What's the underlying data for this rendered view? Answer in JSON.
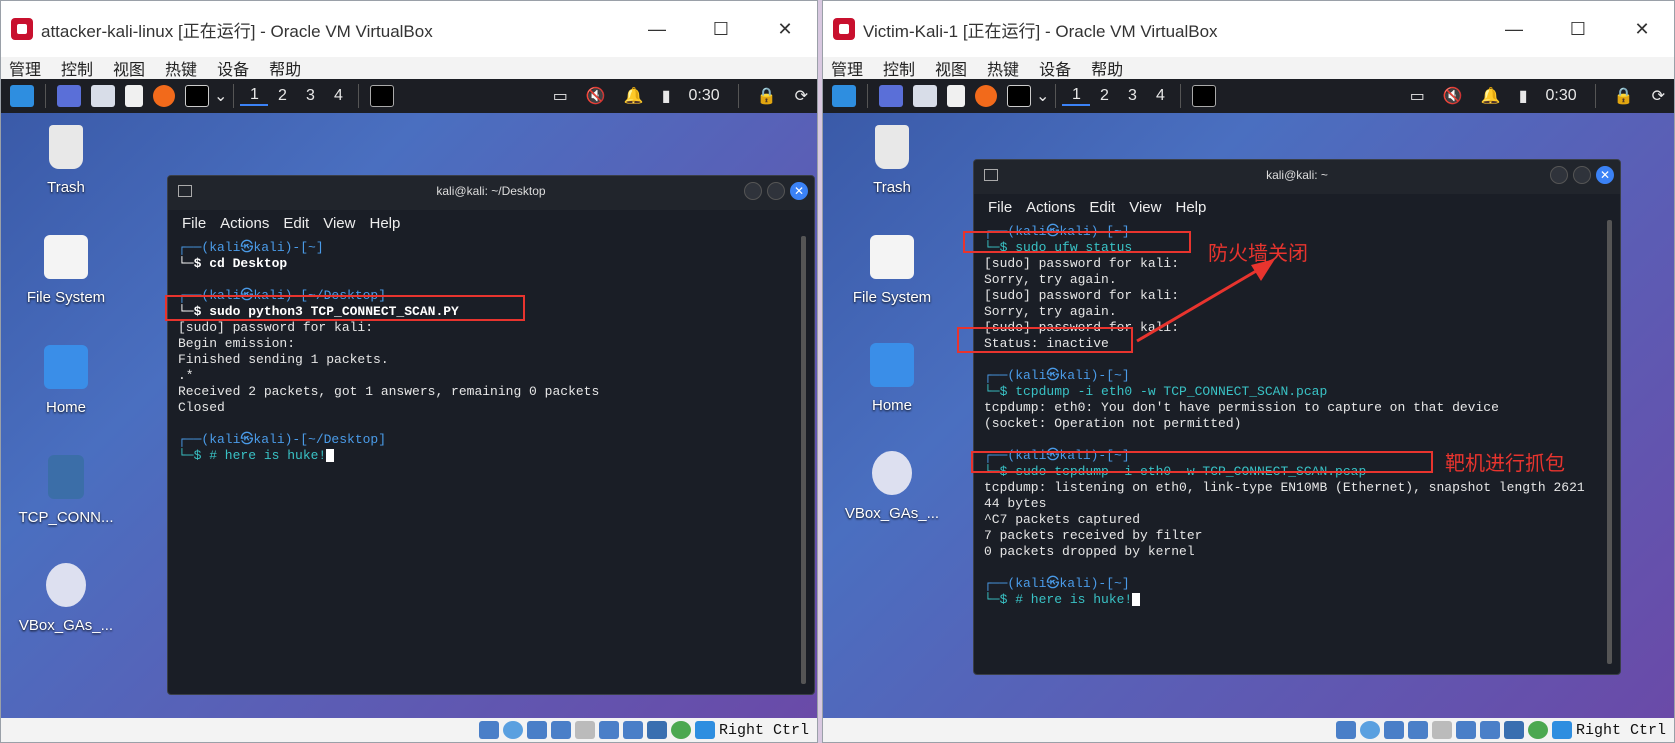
{
  "left_vm": {
    "title": "attacker-kali-linux [正在运行] - Oracle VM VirtualBox",
    "menu": [
      "管理",
      "控制",
      "视图",
      "热键",
      "设备",
      "帮助"
    ],
    "workspaces": [
      "1",
      "2",
      "3",
      "4"
    ],
    "clock": "0:30",
    "desktop_icons": [
      "Trash",
      "File System",
      "Home",
      "TCP_CONN...",
      "VBox_GAs_..."
    ],
    "terminal": {
      "title": "kali@kali: ~/Desktop",
      "menu": [
        "File",
        "Actions",
        "Edit",
        "View",
        "Help"
      ],
      "lines": {
        "p1": "┌──(kali㉿kali)-[~]",
        "c1": "└─$ cd Desktop",
        "p2": "┌──(kali㉿kali)-[~/Desktop]",
        "c2": "└─$ sudo python3 TCP_CONNECT_SCAN.PY",
        "o1": "[sudo] password for kali:",
        "o2": "Begin emission:",
        "o3": "Finished sending 1 packets.",
        "o4": ".*",
        "o5": "Received 2 packets, got 1 answers, remaining 0 packets",
        "o6": "Closed",
        "p3": "┌──(kali㉿kali)-[~/Desktop]",
        "c3": "└─$ # here is huke!"
      }
    },
    "hostkey": "Right Ctrl"
  },
  "right_vm": {
    "title": "Victim-Kali-1 [正在运行] - Oracle VM VirtualBox",
    "menu": [
      "管理",
      "控制",
      "视图",
      "热键",
      "设备",
      "帮助"
    ],
    "workspaces": [
      "1",
      "2",
      "3",
      "4"
    ],
    "clock": "0:30",
    "desktop_icons": [
      "Trash",
      "File System",
      "Home",
      "VBox_GAs_..."
    ],
    "terminal": {
      "title": "kali@kali: ~",
      "menu": [
        "File",
        "Actions",
        "Edit",
        "View",
        "Help"
      ],
      "lines": {
        "p1": "┌──(kali㉿kali)-[~]",
        "c1": "└─$ sudo ufw status",
        "o1": "[sudo] password for kali:",
        "o2": "Sorry, try again.",
        "o3": "[sudo] password for kali:",
        "o4": "Sorry, try again.",
        "o5": "[sudo] password for kali:",
        "o6": "Status: inactive",
        "p2": "┌──(kali㉿kali)-[~]",
        "c2": "└─$ tcpdump -i eth0 -w TCP_CONNECT_SCAN.pcap",
        "o7": "tcpdump: eth0: You don't have permission to capture on that device",
        "o8": "(socket: Operation not permitted)",
        "p3": "┌──(kali㉿kali)-[~]",
        "c3": "└─$ sudo tcpdump -i eth0 -w TCP_CONNECT_SCAN.pcap",
        "o9": "tcpdump: listening on eth0, link-type EN10MB (Ethernet), snapshot length 2621",
        "o10": "44 bytes",
        "o11": "^C7 packets captured",
        "o12": "7 packets received by filter",
        "o13": "0 packets dropped by kernel",
        "p4": "┌──(kali㉿kali)-[~]",
        "c4": "└─$ # here is huke!"
      }
    },
    "annotations": {
      "firewall": "防火墙关闭",
      "capture": "靶机进行抓包"
    },
    "hostkey": "Right Ctrl"
  }
}
